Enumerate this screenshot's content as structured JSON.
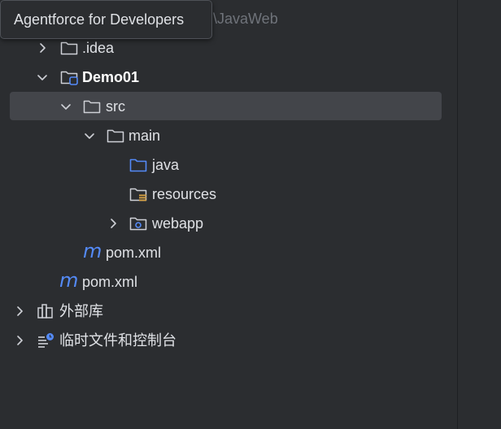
{
  "tooltip": {
    "text": "Agentforce for Developers"
  },
  "root_path_fragment": "\\JavaWeb",
  "tree": {
    "idea": {
      "label": ".idea",
      "icon": "folder-icon",
      "expanded": false
    },
    "demo01": {
      "label": "Demo01",
      "icon": "module-folder-icon",
      "expanded": true
    },
    "src": {
      "label": "src",
      "icon": "folder-icon",
      "expanded": true,
      "selected": true
    },
    "main": {
      "label": "main",
      "icon": "folder-icon",
      "expanded": true
    },
    "java": {
      "label": "java",
      "icon": "source-folder-icon"
    },
    "resources": {
      "label": "resources",
      "icon": "resources-folder-icon"
    },
    "webapp": {
      "label": "webapp",
      "icon": "web-folder-icon",
      "expanded": false
    },
    "pom_demo": {
      "label": "pom.xml",
      "icon": "maven-icon"
    },
    "pom_root": {
      "label": "pom.xml",
      "icon": "maven-icon"
    },
    "external_libs": {
      "label": "外部库",
      "icon": "library-icon",
      "expanded": false
    },
    "scratches": {
      "label": "临时文件和控制台",
      "icon": "scratches-icon",
      "expanded": false
    }
  },
  "maven_glyph": "m",
  "colors": {
    "background": "#2b2d30",
    "selection": "#43454a",
    "text": "#dfe1e5",
    "accent_blue": "#548af7",
    "icon_gray": "#ced0d6",
    "resources_yellow": "#d9a343"
  }
}
